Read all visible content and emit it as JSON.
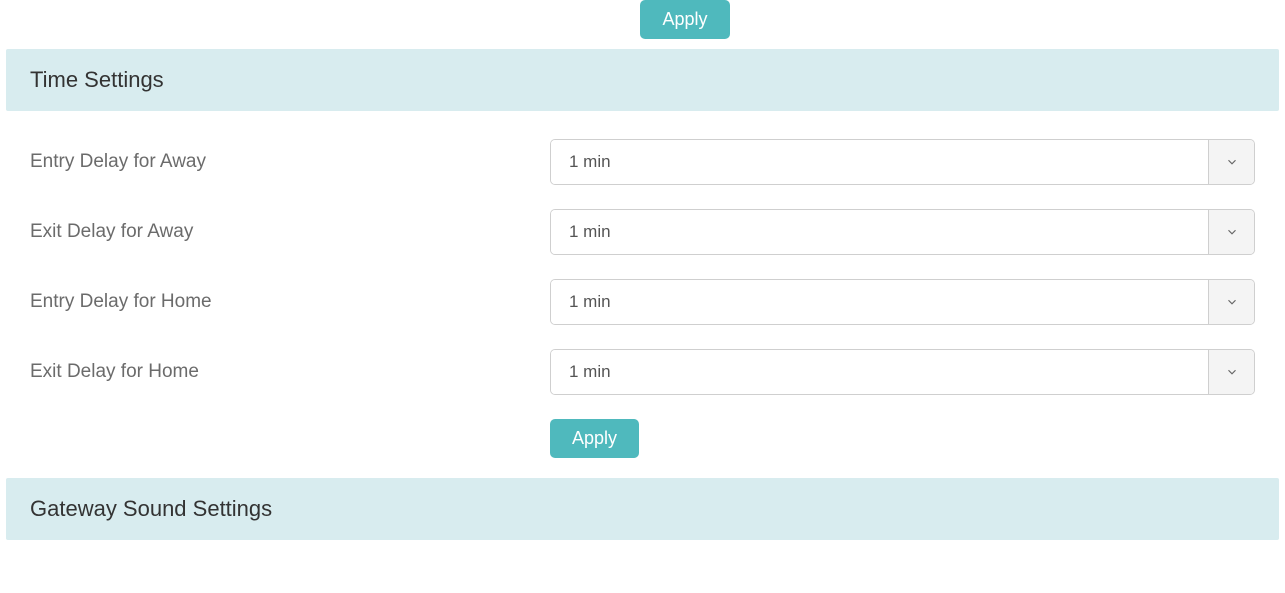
{
  "top": {
    "apply_label": "Apply"
  },
  "time_settings": {
    "header": "Time Settings",
    "rows": [
      {
        "label": "Entry Delay for Away",
        "value": "1 min"
      },
      {
        "label": "Exit Delay for Away",
        "value": "1 min"
      },
      {
        "label": "Entry Delay for Home",
        "value": "1 min"
      },
      {
        "label": "Exit Delay for Home",
        "value": "1 min"
      }
    ],
    "apply_label": "Apply"
  },
  "gateway_sound": {
    "header": "Gateway Sound Settings"
  }
}
